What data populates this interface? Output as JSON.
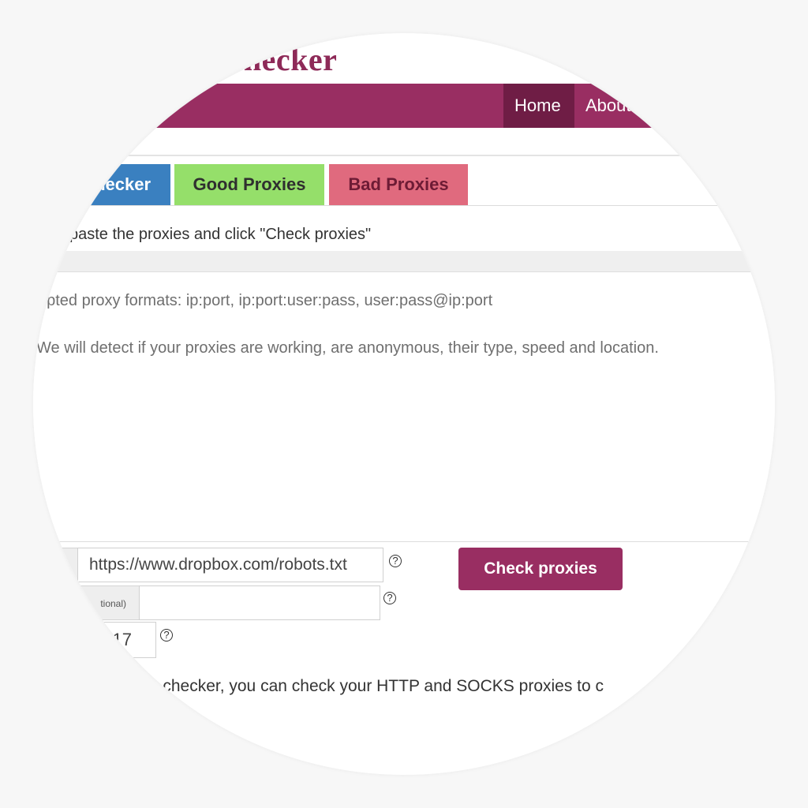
{
  "site": {
    "title": "Proxy Checker"
  },
  "nav": {
    "items": [
      {
        "label": "Home"
      },
      {
        "label": "About"
      }
    ]
  },
  "tabs": [
    {
      "label": "Proxy Checker",
      "color": "#3a80c0"
    },
    {
      "label": "Good Proxies",
      "color": "#95df6a"
    },
    {
      "label": "Bad Proxies",
      "color": "#e06a7e"
    }
  ],
  "instructions": "paste the proxies and click \"Check proxies\"",
  "proxy_box": {
    "placeholder_line1": "ccepted proxy formats: ip:port, ip:port:user:pass, user:pass@ip:port",
    "placeholder_line2": "We will detect if your proxies are working, are anonymous, their type, speed and location."
  },
  "form": {
    "target_url": "https://www.dropbox.com/robots.txt",
    "optional_label": "tional)",
    "optional_value": "",
    "number_value": "17",
    "help_glyph": "?",
    "submit_label": "Check proxies"
  },
  "description": "y checker, you can check your HTTP and SOCKS proxies to c",
  "colors": {
    "brand": "#992e62",
    "nav_active": "#6f1d45"
  }
}
